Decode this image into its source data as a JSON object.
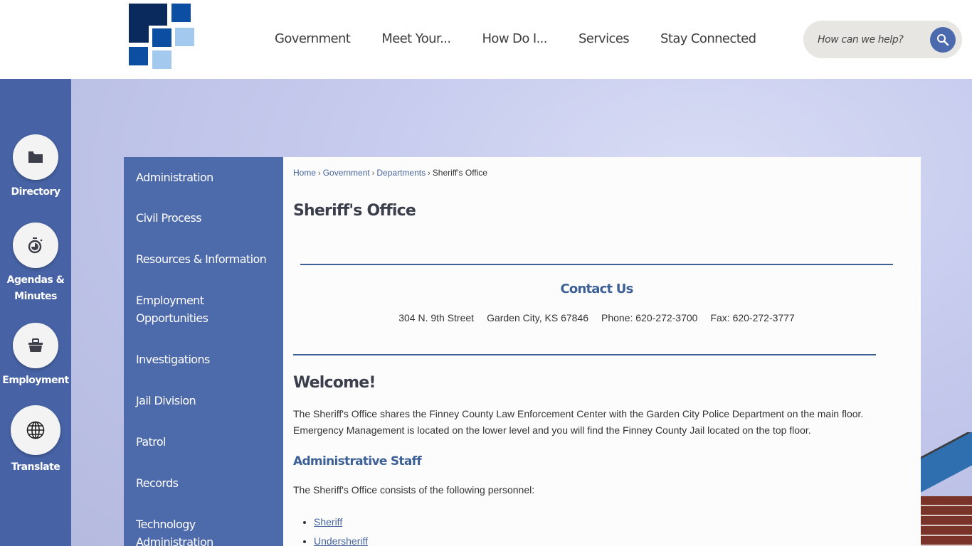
{
  "header": {
    "logo_alt": "Finney County logo",
    "nav": [
      {
        "label": "Government"
      },
      {
        "label": "Meet Your..."
      },
      {
        "label": "How Do I..."
      },
      {
        "label": "Services"
      },
      {
        "label": "Stay Connected"
      }
    ],
    "search": {
      "placeholder": "How can we help?",
      "icon": "search-icon"
    }
  },
  "quick_links": [
    {
      "label": "Directory",
      "icon": "folder-icon"
    },
    {
      "label": "Agendas & Minutes",
      "icon": "stopwatch-icon"
    },
    {
      "label": "Employment",
      "icon": "toolbox-icon"
    },
    {
      "label": "Translate",
      "icon": "globe-icon"
    }
  ],
  "subnav": [
    {
      "label": "Administration"
    },
    {
      "label": "Civil Process"
    },
    {
      "label": "Resources & Information"
    },
    {
      "label": "Employment Opportunities"
    },
    {
      "label": "Investigations"
    },
    {
      "label": "Jail Division"
    },
    {
      "label": "Patrol"
    },
    {
      "label": "Records"
    },
    {
      "label": "Technology Administration"
    }
  ],
  "breadcrumb": {
    "items": [
      {
        "label": "Home"
      },
      {
        "label": "Government"
      },
      {
        "label": "Departments"
      }
    ],
    "current": "Sheriff's Office",
    "separator": "›"
  },
  "page": {
    "title": "Sheriff's Office",
    "contact": {
      "heading": "Contact Us",
      "address": "304 N. 9th Street",
      "city": "Garden City, KS 67846",
      "phone": "Phone: 620-272-3700",
      "fax": "Fax: 620-272-3777"
    },
    "welcome_heading": "Welcome!",
    "intro": "The Sheriff's Office shares the Finney County Law Enforcement Center with the Garden City Police Department on the main floor. Emergency Management is located on the lower level and you will find the Finney County Jail located on the top floor.",
    "staff_heading": "Administrative Staff",
    "staff_intro": "The Sheriff's Office consists of the following personnel:",
    "staff_links": [
      {
        "label": "Sheriff"
      },
      {
        "label": "Undersheriff"
      }
    ]
  },
  "colors": {
    "brand_blue": "#4763a5",
    "subnav_blue": "#4d6aab",
    "heading_blue": "#3d6097",
    "link_blue": "#46659d",
    "logo_navy": "#0a2a5e",
    "logo_mid": "#0b4ea2",
    "logo_light": "#a3c9ef"
  }
}
